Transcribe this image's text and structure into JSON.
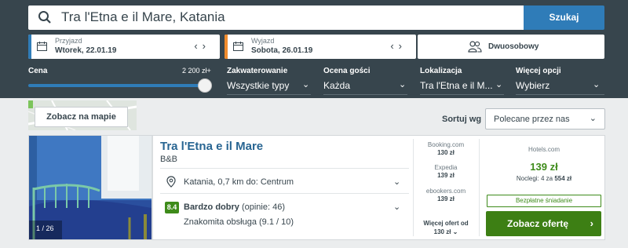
{
  "search": {
    "query": "Tra l'Etna e il Mare, Katania",
    "button": "Szukaj"
  },
  "checkin": {
    "label": "Przyjazd",
    "date": "Wtorek, 22.01.19",
    "accent": "#2f7cb8"
  },
  "checkout": {
    "label": "Wyjazd",
    "date": "Sobota, 26.01.19",
    "accent": "#f08c2d"
  },
  "room": {
    "value": "Dwuosobowy"
  },
  "filters": {
    "price": {
      "label": "Cena",
      "max": "2 200 zł+",
      "level": 1.0
    },
    "accommodation": {
      "label": "Zakwaterowanie",
      "value": "Wszystkie typy"
    },
    "rating": {
      "label": "Ocena gości",
      "value": "Każda"
    },
    "location": {
      "label": "Lokalizacja",
      "value": "Tra l'Etna e il M..."
    },
    "more": {
      "label": "Więcej opcji",
      "value": "Wybierz"
    }
  },
  "map": {
    "button": "Zobacz na mapie"
  },
  "sort": {
    "label": "Sortuj wg",
    "value": "Polecane przez nas"
  },
  "hotel": {
    "name": "Tra l'Etna e il Mare",
    "type": "B&B",
    "photo_count": "1 / 26",
    "location": "Katania, 0,7 km do: Centrum",
    "score": "8.4",
    "rating_label": "Bardzo dobry",
    "rating_reviews": "(opinie: 46)",
    "service": "Znakomita obsługa (9.1 / 10)"
  },
  "offers": [
    {
      "site": "Booking.com",
      "price": "130 zł"
    },
    {
      "site": "Expedia",
      "price": "139 zł"
    },
    {
      "site": "ebookers.com",
      "price": "139 zł"
    }
  ],
  "more_offers": {
    "label": "Więcej ofert od",
    "price": "130 zł"
  },
  "best_deal": {
    "site": "Hotels.com",
    "price": "139 zł",
    "nights_prefix": "Noclegi: 4 za",
    "nights_total": "554 zł",
    "breakfast": "Bezpłatne śniadanie",
    "button": "Zobacz ofertę"
  }
}
